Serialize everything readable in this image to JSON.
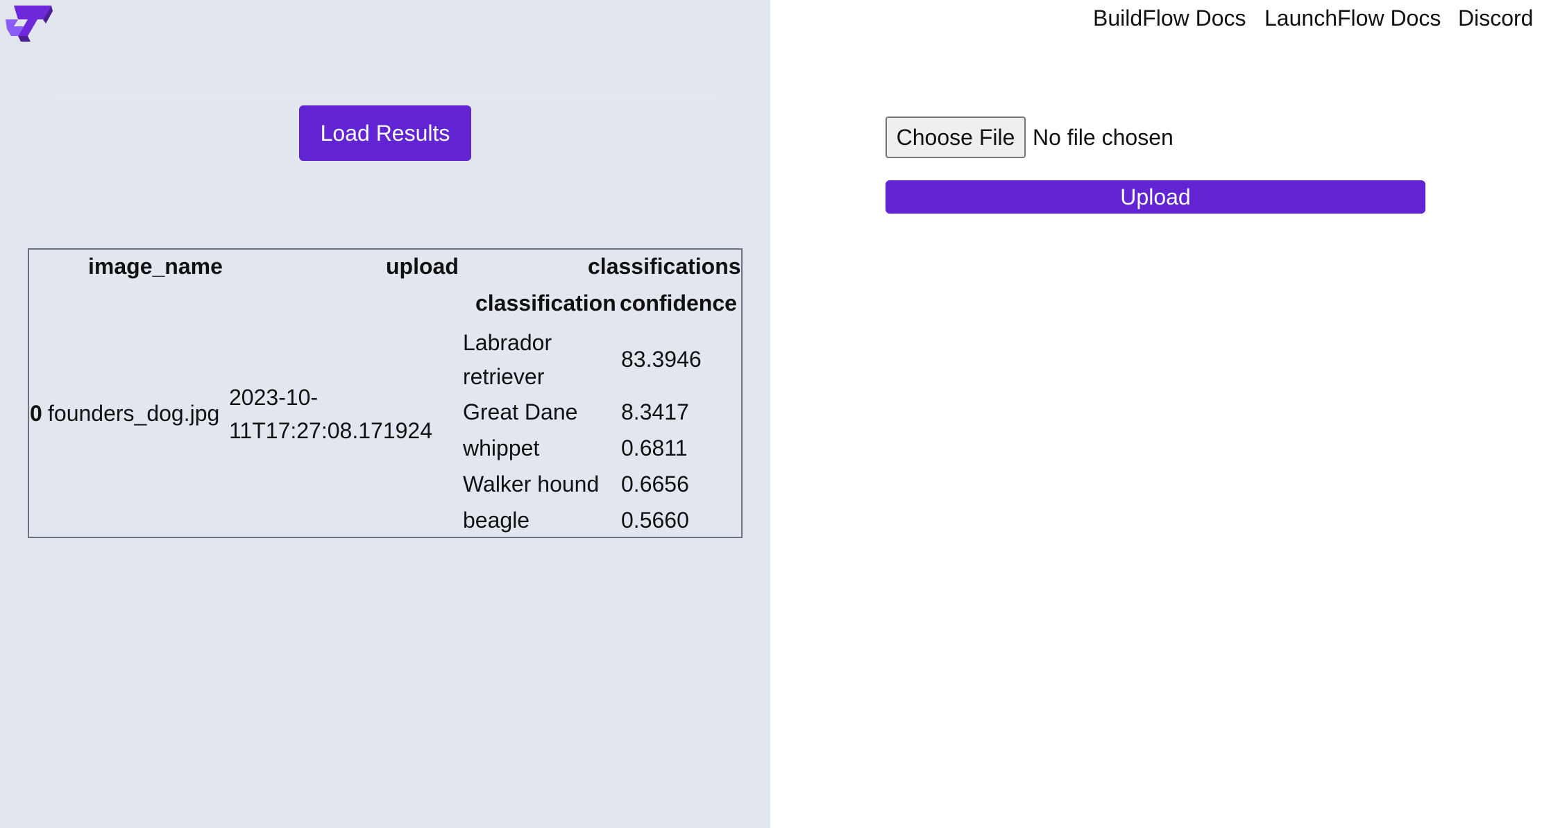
{
  "nav": {
    "links": [
      "BuildFlow Docs",
      "LaunchFlow Docs",
      "Discord"
    ]
  },
  "logo": {
    "icon": "launchflow-logo-icon",
    "color": "#6d28d9"
  },
  "left_panel": {
    "load_button_label": "Load Results",
    "background": "#e2e6ee"
  },
  "table": {
    "headers": {
      "image_name": "image_name",
      "upload": "upload",
      "classifications": "classifications",
      "classification": "classification",
      "confidence": "confidence"
    },
    "rows": [
      {
        "index": "0",
        "image_name": "founders_dog.jpg",
        "upload_line1": "2023-10-",
        "upload_line2": "11T17:27:08.171924",
        "classifications": [
          {
            "classification_line1": "Labrador",
            "classification_line2": "retriever",
            "confidence": "83.3946"
          },
          {
            "classification": "Great Dane",
            "confidence": "8.3417"
          },
          {
            "classification": "whippet",
            "confidence": "0.6811"
          },
          {
            "classification": "Walker hound",
            "confidence": "0.6656"
          },
          {
            "classification": "beagle",
            "confidence": "0.5660"
          }
        ]
      }
    ]
  },
  "upload_form": {
    "choose_file_label": "Choose File",
    "file_status": "No file chosen",
    "upload_label": "Upload"
  },
  "colors": {
    "accent": "#6224d2",
    "panel": "#e2e6ee"
  }
}
